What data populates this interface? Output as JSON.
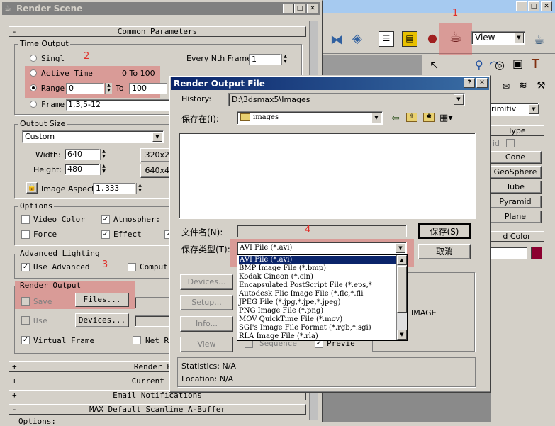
{
  "main": {
    "title": "Render Scene",
    "common_params": "Common Parameters",
    "time_output": {
      "label": "Time Output",
      "single": "Singl",
      "every_nth": "Every Nth Frame:",
      "every_nth_value": "1",
      "active_time": "Active Time",
      "active_range": "0 To 100",
      "range": "Range",
      "range_from": "0",
      "to": "To",
      "range_to": "100",
      "frames": "Frame",
      "frames_value": "1,3,5-12"
    },
    "output_size": {
      "label": "Output Size",
      "preset": "Custom",
      "width_label": "Width:",
      "width": "640",
      "height_label": "Height:",
      "height": "480",
      "preset1": "320x2",
      "preset2": "640x4",
      "aspect_label": "Image Aspect:",
      "aspect": "1.333"
    },
    "options": {
      "label": "Options",
      "video_color": "Video Color",
      "atmospheric": "Atmospher:",
      "force": "Force",
      "effects": "Effect"
    },
    "advanced_lighting": {
      "label": "Advanced Lighting",
      "use_advanced": "Use Advanced",
      "compute": "Comput"
    },
    "render_output": {
      "label": "Render Output",
      "save": "Save",
      "files": "Files...",
      "use": "Use",
      "devices": "Devices...",
      "virtual_frame": "Virtual Frame",
      "net": "Net R"
    },
    "rollups": [
      {
        "sign": "+",
        "title": "Render Ele"
      },
      {
        "sign": "+",
        "title": "Current Ren"
      },
      {
        "sign": "+",
        "title": "Email Notifications"
      },
      {
        "sign": "-",
        "title": "MAX Default Scanline A-Buffer"
      }
    ],
    "options_bottom": "Options:"
  },
  "annotations": {
    "n1": "1",
    "n2": "2",
    "n3": "3",
    "n4": "4"
  },
  "right_panel": {
    "view_dropdown": "View",
    "primitives": "rimitiv",
    "type_header": "Type",
    "aid": "id",
    "buttons": [
      "Cone",
      "GeoSphere",
      "Tube",
      "Pyramid",
      "Plane"
    ],
    "color_header": "d Color",
    "color_swatch": "#8b0030"
  },
  "dialog": {
    "title": "Render Output File",
    "history_label": "History:",
    "history_value": "D:\\3dsmax5\\Images",
    "save_in_label": "保存在(I):",
    "save_in_value": "images",
    "filename_label": "文件名(N):",
    "filename_value": "",
    "filetype_label": "保存类型(T):",
    "filetype_value": "AVI File (*.avi)",
    "save_button": "保存(S)",
    "cancel_button": "取消",
    "left_buttons": [
      "Devices...",
      "Setup...",
      "Info...",
      "View"
    ],
    "sequence": "Sequence",
    "preview": "Previe",
    "image_label": "IMAGE",
    "statistics": "Statistics: N/A",
    "location": "Location: N/A",
    "filetypes": [
      "AVI File (*.avi)",
      "BMP Image File (*.bmp)",
      "Kodak Cineon (*.cin)",
      "Encapsulated PostScript File (*.eps,*",
      "Autodesk Flic Image File (*.flc,*.fli",
      "JPEG File (*.jpg,*.jpe,*.jpeg)",
      "PNG Image File (*.png)",
      "MOV QuickTime File (*.mov)",
      "SGI's Image File Format (*.rgb,*.sgi)",
      "RLA Image File (*.rla)"
    ]
  },
  "colors": {
    "highlight": "#e15a5a",
    "titlebar": "#0a246a",
    "selection": "#0a246a"
  }
}
